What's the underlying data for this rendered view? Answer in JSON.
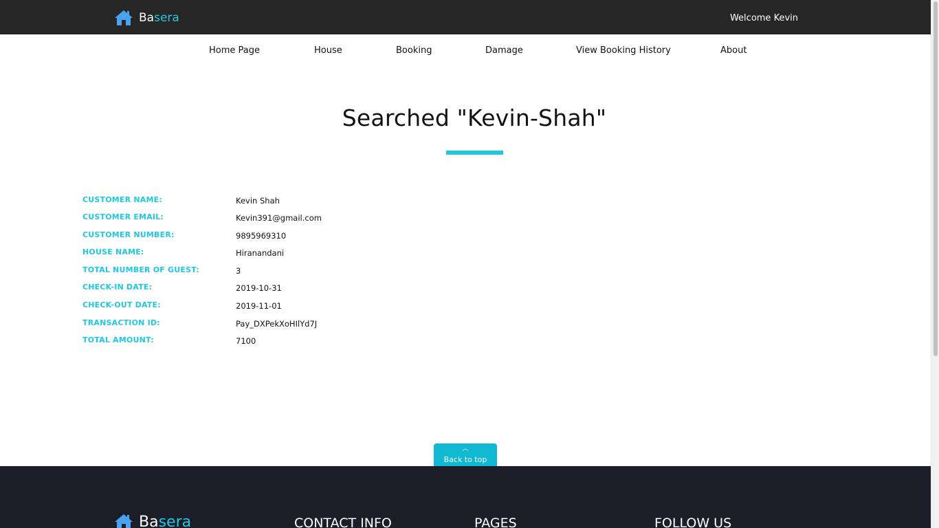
{
  "header": {
    "brand_prefix": "Ba",
    "brand_suffix": "sera",
    "welcome": "Welcome Kevin"
  },
  "nav": {
    "items": [
      "Home Page",
      "House",
      "Booking",
      "Damage",
      "View Booking History",
      "About"
    ]
  },
  "page": {
    "title": "Searched \"Kevin-Shah\""
  },
  "details": [
    {
      "label": "CUSTOMER NAME:",
      "value": "Kevin Shah"
    },
    {
      "label": "CUSTOMER EMAIL:",
      "value": "Kevin391@gmail.com"
    },
    {
      "label": "CUSTOMER NUMBER:",
      "value": "9895969310"
    },
    {
      "label": "HOUSE NAME:",
      "value": "Hiranandani"
    },
    {
      "label": "TOTAL NUMBER OF GUEST:",
      "value": "3"
    },
    {
      "label": "CHECK-IN DATE:",
      "value": "2019-10-31"
    },
    {
      "label": "CHECK-OUT DATE:",
      "value": "2019-11-01"
    },
    {
      "label": "TRANSACTION ID:",
      "value": "Pay_DXPekXoHIlYd7J"
    },
    {
      "label": "TOTAL AMOUNT:",
      "value": "7100"
    }
  ],
  "back_to_top": {
    "label": "Back to top",
    "icon": "chevron-up-icon"
  },
  "footer": {
    "brand_prefix": "Ba",
    "brand_suffix": "sera",
    "contact_heading": "CONTACT INFO",
    "pages_heading": "PAGES",
    "follow_heading": "FOLLOW US"
  },
  "colors": {
    "accent": "#1ec8e0",
    "topbar": "#262626",
    "footer": "#1b1e29",
    "logo_icon": "#4aa3f0"
  }
}
